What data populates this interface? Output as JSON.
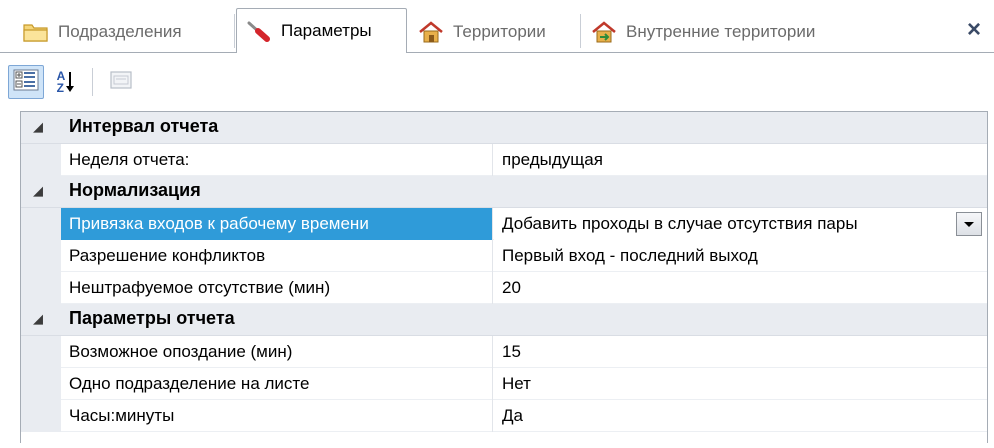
{
  "tabs": [
    {
      "label": "Подразделения",
      "icon": "folder-icon",
      "active": false
    },
    {
      "label": "Параметры",
      "icon": "screwdriver-icon",
      "active": true
    },
    {
      "label": "Территории",
      "icon": "house-icon",
      "active": false
    },
    {
      "label": "Внутренние территории",
      "icon": "house-arrows-icon",
      "active": false
    }
  ],
  "close_label": "×",
  "toolbar": {
    "categorized_icon": "categorized-icon",
    "sort_icon": "sort-az-icon",
    "sort_letters": [
      "A",
      "Z"
    ],
    "pages_icon": "property-pages-icon"
  },
  "grid": {
    "categories": [
      {
        "label": "Интервал отчета",
        "properties": [
          {
            "name": "Неделя отчета:",
            "value": "предыдущая"
          }
        ]
      },
      {
        "label": "Нормализация",
        "properties": [
          {
            "name": "Привязка входов к рабочему времени",
            "value": "Добавить проходы в случае отсутствия пары",
            "selected": true,
            "has_dropdown": true
          },
          {
            "name": "Разрешение конфликтов",
            "value": "Первый вход - последний выход"
          },
          {
            "name": "Нештрафуемое отсутствие (мин)",
            "value": "20"
          }
        ]
      },
      {
        "label": "Параметры отчета",
        "properties": [
          {
            "name": "Возможное опоздание (мин)",
            "value": "15"
          },
          {
            "name": "Одно подразделение на листе",
            "value": "Нет"
          },
          {
            "name": "Часы:минуты",
            "value": "Да"
          }
        ]
      }
    ]
  },
  "colors": {
    "selection": "#2f9bd9",
    "category_bg": "#e9ecf1",
    "border": "#a5acb5"
  }
}
